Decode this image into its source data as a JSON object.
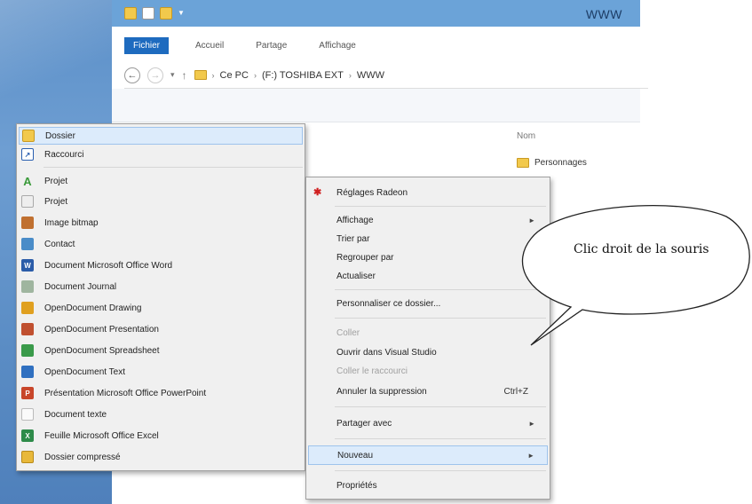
{
  "window": {
    "title": "WWW",
    "tabs": [
      {
        "label": "Fichier"
      },
      {
        "label": "Accueil"
      },
      {
        "label": "Partage"
      },
      {
        "label": "Affichage"
      }
    ],
    "breadcrumb": [
      "Ce PC",
      "(F:) TOSHIBA EXT",
      "WWW"
    ],
    "column_header": "Nom",
    "file": "Personnages"
  },
  "new_submenu": {
    "items": [
      {
        "label": "Dossier",
        "icon": "folder-icon",
        "color": "#f2c94c"
      },
      {
        "label": "Raccourci",
        "icon": "shortcut-icon",
        "color": "#2a5fb0"
      },
      {
        "label": "Projet",
        "icon": "project-a-icon",
        "color": "#3a9a3a"
      },
      {
        "label": "Projet",
        "icon": "project-doc-icon",
        "color": "#d8d8d8"
      },
      {
        "label": "Image bitmap",
        "icon": "bitmap-icon",
        "color": "#c07030"
      },
      {
        "label": "Contact",
        "icon": "contact-icon",
        "color": "#4a8cc8"
      },
      {
        "label": "Document Microsoft Office Word",
        "icon": "word-icon",
        "color": "#2b5ca8"
      },
      {
        "label": "Document Journal",
        "icon": "journal-icon",
        "color": "#7a9a7a"
      },
      {
        "label": "OpenDocument Drawing",
        "icon": "odg-icon",
        "color": "#e0a020"
      },
      {
        "label": "OpenDocument Presentation",
        "icon": "odp-icon",
        "color": "#c05030"
      },
      {
        "label": "OpenDocument Spreadsheet",
        "icon": "ods-icon",
        "color": "#3a9a4a"
      },
      {
        "label": "OpenDocument Text",
        "icon": "odt-icon",
        "color": "#3070c0"
      },
      {
        "label": "Présentation Microsoft Office PowerPoint",
        "icon": "powerpoint-icon",
        "color": "#c8462a"
      },
      {
        "label": "Document texte",
        "icon": "text-doc-icon",
        "color": "#e8e8e8"
      },
      {
        "label": "Feuille Microsoft Office Excel",
        "icon": "excel-icon",
        "color": "#2e8b4a"
      },
      {
        "label": "Dossier compressé",
        "icon": "zip-folder-icon",
        "color": "#e8b83a"
      }
    ]
  },
  "context_menu": {
    "items": [
      {
        "label": "Réglages Radeon"
      },
      {
        "label": "Affichage"
      },
      {
        "label": "Trier par"
      },
      {
        "label": "Regrouper par"
      },
      {
        "label": "Actualiser"
      },
      {
        "label": "Personnaliser ce dossier..."
      },
      {
        "label": "Coller"
      },
      {
        "label": "Ouvrir dans Visual Studio"
      },
      {
        "label": "Coller le raccourci"
      },
      {
        "label": "Annuler la suppression",
        "shortcut": "Ctrl+Z"
      },
      {
        "label": "Partager avec"
      },
      {
        "label": "Nouveau"
      },
      {
        "label": "Propriétés"
      }
    ]
  },
  "callout": {
    "text": "Clic droit de la souris"
  }
}
